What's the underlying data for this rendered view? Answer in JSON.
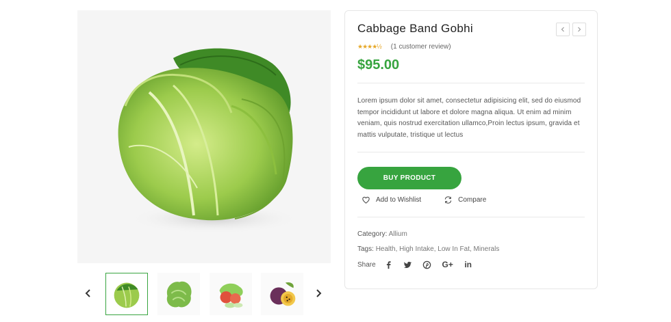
{
  "product": {
    "title": "Cabbage Band Gobhi",
    "rating_stars": "★★★★½",
    "rating": 4.5,
    "review_text": "(1 customer review)",
    "price": "$95.00",
    "description": "Lorem ipsum dolor sit amet, consectetur adipisicing elit, sed do eiusmod tempor incididunt ut labore et dolore magna aliqua. Ut enim ad minim veniam, quis nostrud exercitation ullamco,Proin lectus ipsum, gravida et mattis vulputate, tristique ut lectus",
    "buy_label": "BUY PRODUCT",
    "wishlist_label": "Add to Wishlist",
    "compare_label": "Compare",
    "category_label": "Category:",
    "category_value": "Allium",
    "tags_label": "Tags:",
    "tags_value": "Health, High Intake, Low In Fat, Minerals",
    "share_label": "Share"
  },
  "colors": {
    "accent": "#37a43f",
    "star": "#e6a829"
  },
  "gallery": {
    "main_image": "cabbage-image",
    "thumbnails": [
      "cabbage-thumb",
      "lettuce-thumb",
      "salad-vegetables-thumb",
      "passion-fruit-thumb"
    ],
    "active_index": 0
  },
  "social": {
    "icons": [
      "facebook-icon",
      "twitter-icon",
      "pinterest-icon",
      "google-plus-icon",
      "linkedin-icon"
    ],
    "google_plus_text": "G+",
    "linkedin_text": "in"
  }
}
